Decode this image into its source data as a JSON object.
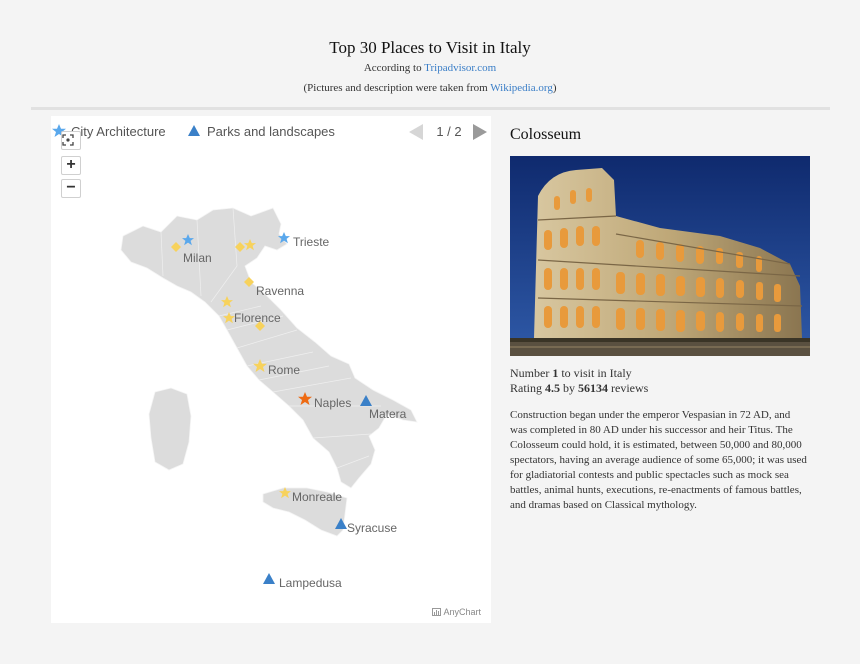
{
  "header": {
    "title": "Top 30 Places to Visit in Italy",
    "according_prefix": "According to ",
    "source_link": "Tripadvisor.com",
    "pictures_prefix": "(Pictures and description were taken from ",
    "pictures_link": "Wikipedia.org",
    "pictures_suffix": ")"
  },
  "map": {
    "legend": [
      {
        "label": "City Architecture",
        "icon": "star-marker-icon",
        "color": "#5aa8ec"
      },
      {
        "label": "Parks and landscapes",
        "icon": "triangle-marker-icon",
        "color": "#3a80c8"
      }
    ],
    "pager": {
      "current": 1,
      "total": 2,
      "text": "1 / 2"
    },
    "zoom": {
      "fit_icon": "fit-to-screen-icon",
      "zoom_in": "+",
      "zoom_out": "−"
    },
    "credit": "AnyChart",
    "colors": {
      "land": "#dcdcdc",
      "border": "#f3f3f3",
      "star_blue": "#5aa8ec",
      "yellow": "#f7d25c",
      "selected": "#ee6a12",
      "triangle": "#3a80c8"
    },
    "places": [
      {
        "name": "Milan",
        "category": "City Architecture",
        "marker": "star-blue"
      },
      {
        "name": "Trieste",
        "category": "City Architecture",
        "marker": "star-blue"
      },
      {
        "name": "Ravenna",
        "category": "City Architecture",
        "marker": "diamond-yellow"
      },
      {
        "name": "Florence",
        "category": "City Architecture",
        "marker": "star-yellow"
      },
      {
        "name": "Rome",
        "category": "City Architecture",
        "marker": "star-yellow"
      },
      {
        "name": "Naples",
        "category": "City Architecture",
        "marker": "star-selected"
      },
      {
        "name": "Matera",
        "category": "Parks and landscapes",
        "marker": "triangle"
      },
      {
        "name": "Monreale",
        "category": "City Architecture",
        "marker": "diamond-yellow"
      },
      {
        "name": "Syracuse",
        "category": "Parks and landscapes",
        "marker": "triangle"
      },
      {
        "name": "Lampedusa",
        "category": "Parks and landscapes",
        "marker": "triangle"
      }
    ]
  },
  "detail": {
    "title": "Colosseum",
    "number_prefix": "Number ",
    "number": "1",
    "number_suffix": " to visit in Italy",
    "rating_prefix": "Rating ",
    "rating": "4.5",
    "rating_mid": " by ",
    "reviews": "56134",
    "reviews_suffix": " reviews",
    "description": "Construction began under the emperor Vespasian in 72 AD, and was completed in 80 AD under his successor and heir Titus. The Colosseum could hold, it is estimated, between 50,000 and 80,000 spectators, having an average audience of some 65,000; it was used for gladiatorial contests and public spectacles such as mock sea battles, animal hunts, executions, re-enactments of famous battles, and dramas based on Classical mythology.",
    "photo": "colosseum-photo"
  }
}
